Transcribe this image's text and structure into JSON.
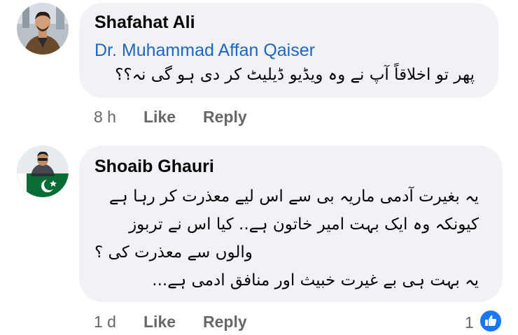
{
  "comments": [
    {
      "author": "Shafahat Ali",
      "mention": "Dr. Muhammad Affan Qaiser",
      "lines": [
        "پھر تو اخلاقاً آپ نے وہ ویڈیو ڈیلیٹ کر دی ہو گی نہ؟؟"
      ],
      "time": "8 h",
      "like_label": "Like",
      "reply_label": "Reply",
      "avatar_icon": "person-avatar-icon"
    },
    {
      "author": "Shoaib Ghauri",
      "lines": [
        "یہ بغیرت آدمی ماریہ بی سے اس لیے معذرت کر رہا ہے",
        "کیونکہ وہ ایک بہت امیر خاتون ہے.. کیا اس نے تربوز",
        "والوں سے معذرت کی ؟",
        "یہ بہت ہی بے غیرت خبیث اور منافق ادمی ہے..."
      ],
      "time": "1 d",
      "like_label": "Like",
      "reply_label": "Reply",
      "reaction_count": "1",
      "reaction_icon": "thumbs-up-icon",
      "avatar_icon": "pakistan-flag-avatar-icon"
    }
  ],
  "colors": {
    "bubble": "#f0f2f5",
    "mention": "#1f66c4",
    "meta": "#65676b",
    "like_badge": "#1877f2"
  }
}
